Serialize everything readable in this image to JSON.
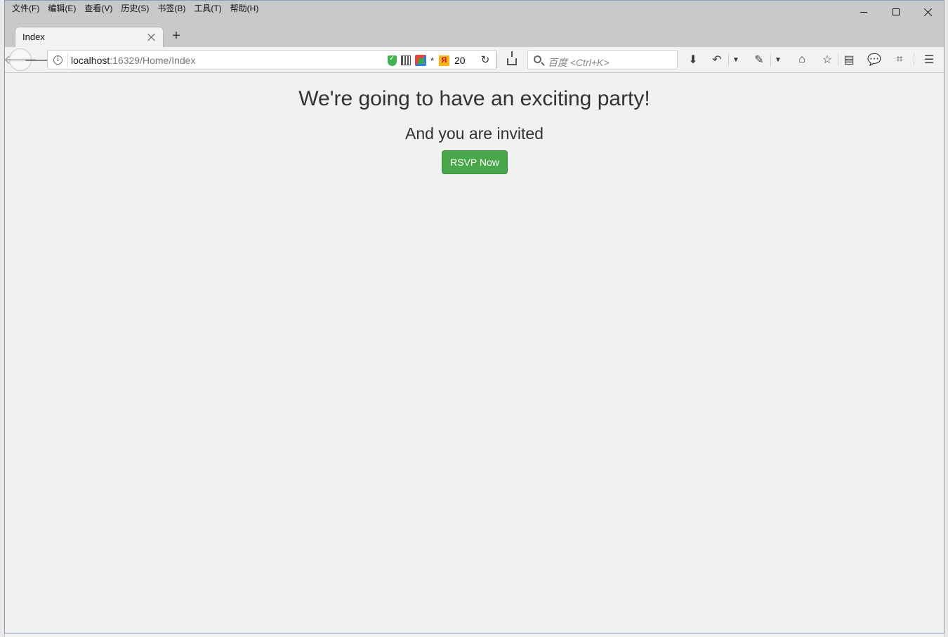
{
  "menu": {
    "items": [
      "文件(F)",
      "编辑(E)",
      "查看(V)",
      "历史(S)",
      "书签(B)",
      "工具(T)",
      "帮助(H)"
    ]
  },
  "tab": {
    "title": "Index"
  },
  "urlbar": {
    "host": "localhost",
    "path": ":16329/Home/Index",
    "badge_count": "20"
  },
  "search": {
    "placeholder": "百度 <Ctrl+K>"
  },
  "page": {
    "headline": "We're going to have an exciting party!",
    "subheadline": "And you are invited",
    "rsvp_label": "RSVP Now"
  },
  "colors": {
    "button_bg": "#4aa64a",
    "page_bg": "#f1f1f1",
    "chrome_bg": "#c9c9c9"
  },
  "icons": [
    "back-icon",
    "forward-icon",
    "info-icon",
    "shield-icon",
    "qr-code-icon",
    "multi-color-icon",
    "yandex-icon",
    "reload-icon",
    "download-tray-icon",
    "search-icon",
    "download-icon",
    "undo-icon",
    "feather-icon",
    "home-icon",
    "star-icon",
    "clipboard-icon",
    "chat-icon",
    "crop-icon",
    "menu-icon"
  ]
}
